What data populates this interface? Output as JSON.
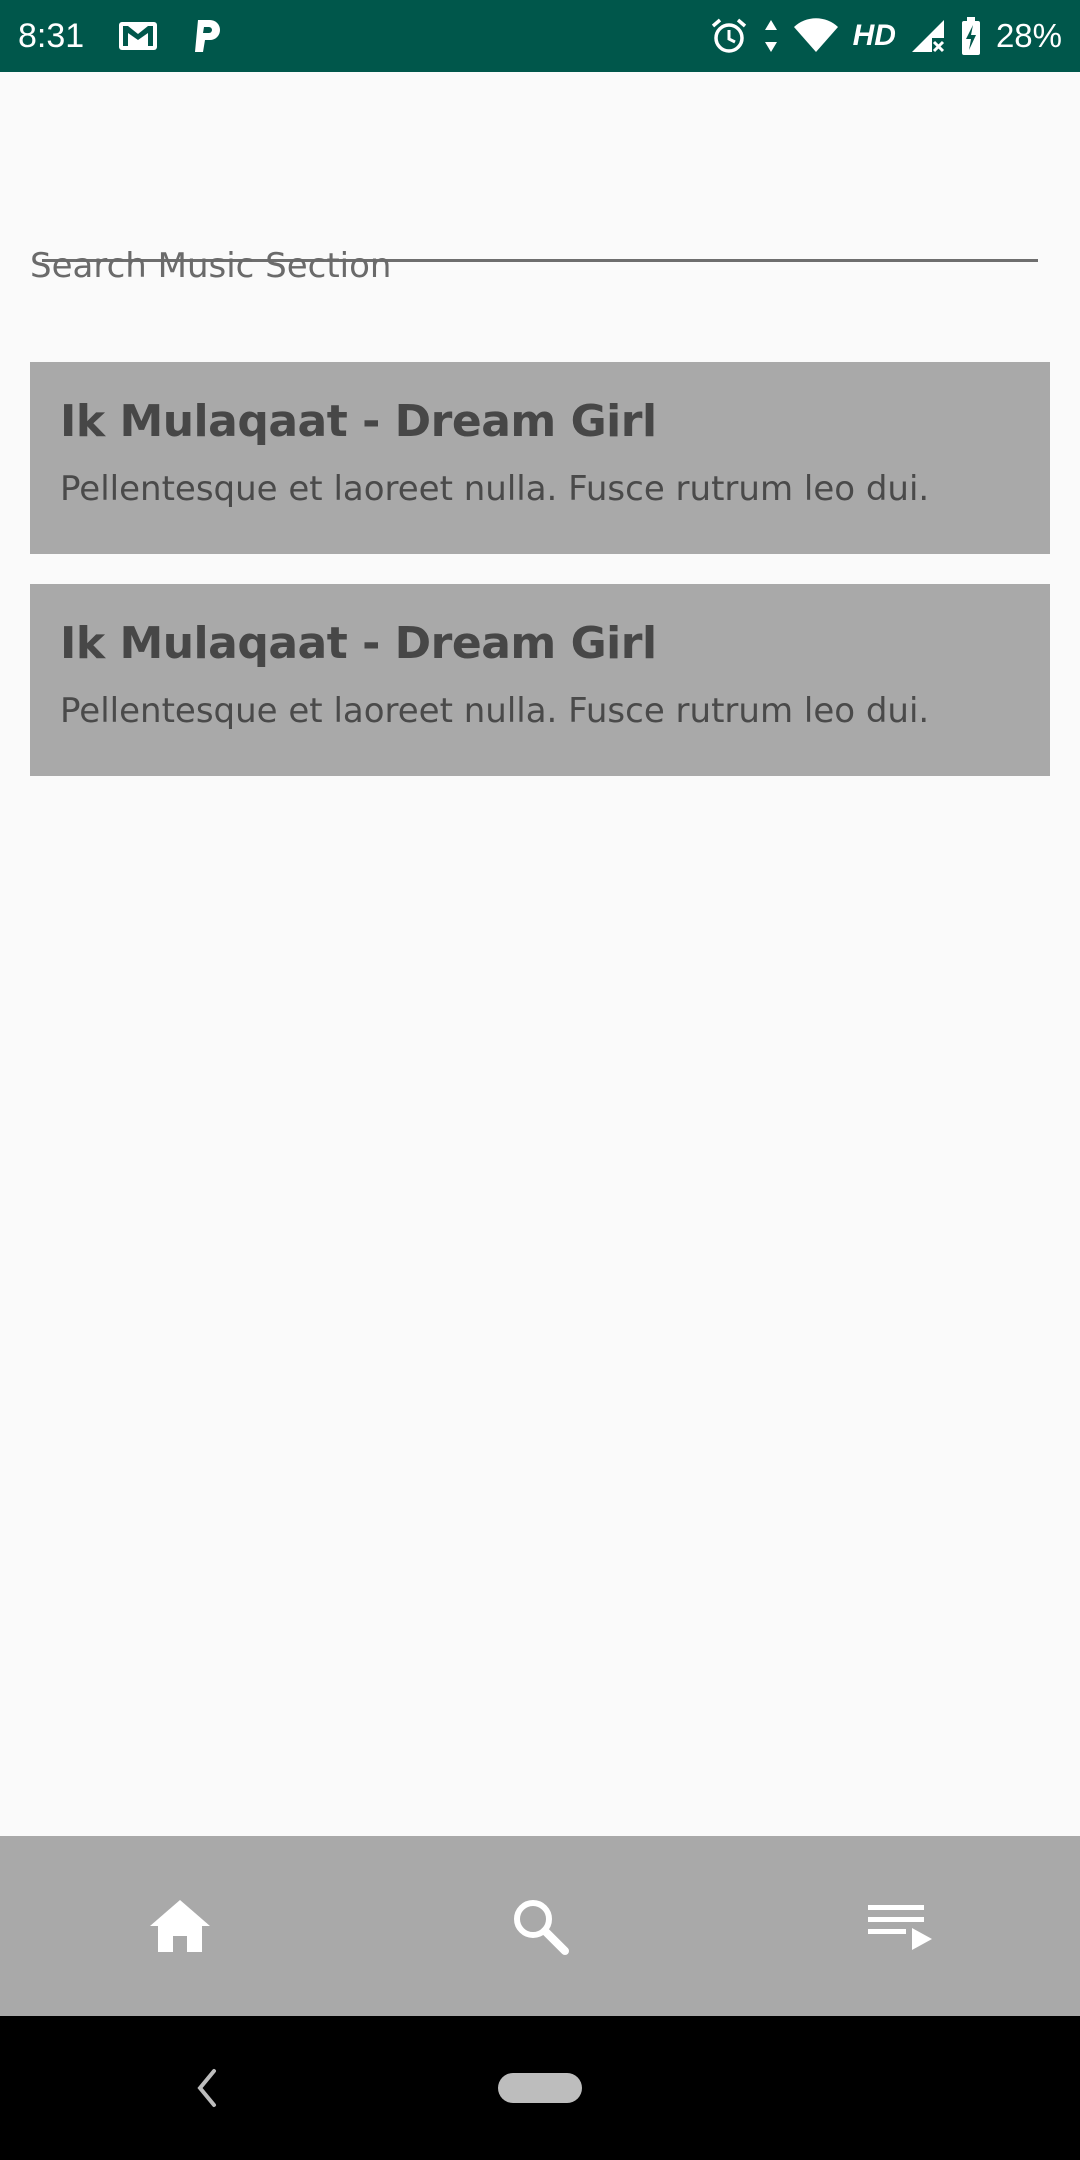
{
  "status_bar": {
    "time": "8:31",
    "network": "HD",
    "battery": "28%",
    "background_color": "#00574b",
    "icons": [
      "gmail-icon",
      "parking-icon",
      "alarm-icon",
      "data-arrows-icon",
      "wifi-icon",
      "cell-signal-icon",
      "battery-icon"
    ]
  },
  "search": {
    "value": "",
    "label": "Search Music Section"
  },
  "songs": [
    {
      "title": "Ik Mulaqaat - Dream Girl",
      "description": "Pellentesque et laoreet nulla. Fusce rutrum leo dui."
    },
    {
      "title": "Ik Mulaqaat - Dream Girl",
      "description": "Pellentesque et laoreet nulla. Fusce rutrum leo dui."
    }
  ],
  "bottom_nav": {
    "items": [
      "home-icon",
      "search-icon",
      "playlist-icon"
    ],
    "background_color": "#a9a9a9"
  },
  "system_nav": {
    "items": [
      "back-icon",
      "home-pill"
    ]
  }
}
